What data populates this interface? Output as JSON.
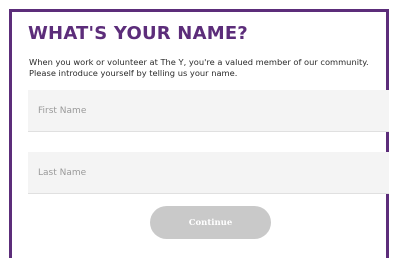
{
  "form": {
    "title": "WHAT'S YOUR NAME?",
    "intro": "When you work or volunteer at The Y, you're a valued member of our community. Please introduce yourself by telling us your name.",
    "first_name": {
      "placeholder": "First Name",
      "value": ""
    },
    "last_name": {
      "placeholder": "Last Name",
      "value": ""
    },
    "continue_label": "Continue",
    "continue_enabled": false
  },
  "colors": {
    "accent": "#5c2d7a",
    "field_background": "#f4f4f4",
    "button_disabled": "#c9c9c9"
  }
}
